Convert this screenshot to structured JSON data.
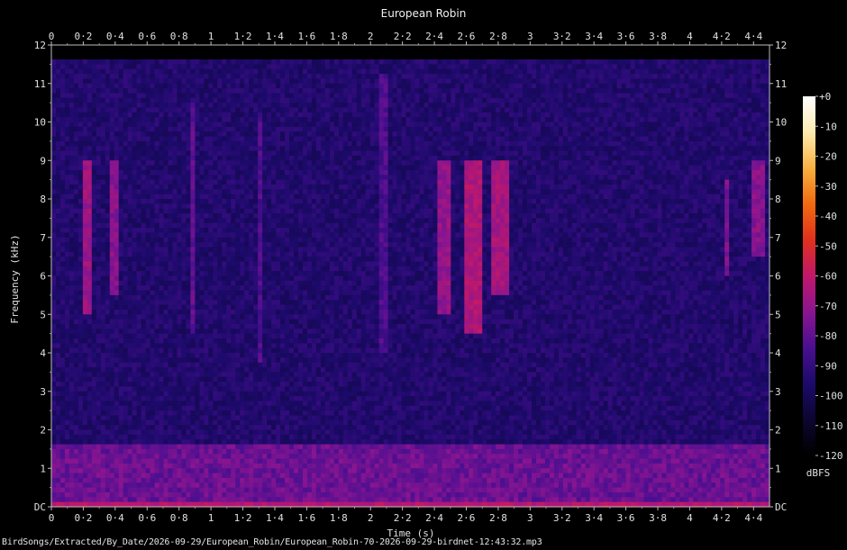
{
  "chart_data": {
    "type": "heatmap",
    "title": "European Robin",
    "xlabel": "Time (s)",
    "ylabel": "Frequency (kHz)",
    "x_ticks": [
      "0",
      "0·2",
      "0·4",
      "0·6",
      "0·8",
      "1",
      "1·2",
      "1·4",
      "1·6",
      "1·8",
      "2",
      "2·2",
      "2·4",
      "2·6",
      "2·8",
      "3",
      "3·2",
      "3·4",
      "3·6",
      "3·8",
      "4",
      "4·2",
      "4·4"
    ],
    "y_ticks": [
      "DC",
      "1",
      "2",
      "3",
      "4",
      "5",
      "6",
      "7",
      "8",
      "9",
      "10",
      "11",
      "12"
    ],
    "xlim": [
      0,
      4.5
    ],
    "ylim": [
      0,
      12
    ],
    "colorbar": {
      "label": "dBFS",
      "ticks": [
        "+0",
        "-10",
        "-20",
        "-30",
        "-40",
        "-50",
        "-60",
        "-70",
        "-80",
        "-90",
        "-100",
        "-110",
        "-120"
      ],
      "range": [
        -120,
        0
      ],
      "colors": [
        "#000000",
        "#0c0630",
        "#1c0a6a",
        "#4a0f90",
        "#8a1590",
        "#c0186a",
        "#e0301c",
        "#f06a10",
        "#f8b040",
        "#fcebb0",
        "#ffffff"
      ]
    },
    "background_level_dbfs": -95,
    "low_frequency_energy": {
      "freq_khz": [
        0,
        1.6
      ],
      "level_dbfs": -78
    },
    "bird_events": [
      {
        "time_s": [
          0.2,
          0.25
        ],
        "freq_khz": [
          5.0,
          9.0
        ],
        "level_dbfs": -68
      },
      {
        "time_s": [
          0.37,
          0.42
        ],
        "freq_khz": [
          5.5,
          9.0
        ],
        "level_dbfs": -72
      },
      {
        "time_s": [
          0.87,
          0.89
        ],
        "freq_khz": [
          4.5,
          10.5
        ],
        "level_dbfs": -80
      },
      {
        "time_s": [
          1.3,
          1.32
        ],
        "freq_khz": [
          3.8,
          10.2
        ],
        "level_dbfs": -84
      },
      {
        "time_s": [
          2.07,
          2.09
        ],
        "freq_khz": [
          4.0,
          11.3
        ],
        "level_dbfs": -84
      },
      {
        "time_s": [
          2.42,
          2.5
        ],
        "freq_khz": [
          5.0,
          9.0
        ],
        "level_dbfs": -70
      },
      {
        "time_s": [
          2.6,
          2.7
        ],
        "freq_khz": [
          4.5,
          9.0
        ],
        "level_dbfs": -64
      },
      {
        "time_s": [
          2.78,
          2.85
        ],
        "freq_khz": [
          5.5,
          9.0
        ],
        "level_dbfs": -66
      },
      {
        "time_s": [
          4.22,
          4.25
        ],
        "freq_khz": [
          6.0,
          8.5
        ],
        "level_dbfs": -75
      },
      {
        "time_s": [
          4.4,
          4.45
        ],
        "freq_khz": [
          6.5,
          9.0
        ],
        "level_dbfs": -72
      }
    ]
  },
  "footer": {
    "filename": "BirdSongs/Extracted/By_Date/2026-09-29/European_Robin/European_Robin-70-2026-09-29-birdnet-12:43:32.mp3"
  }
}
